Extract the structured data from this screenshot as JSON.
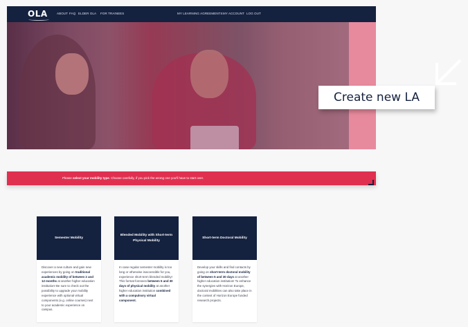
{
  "nav": {
    "logo": "OLA",
    "links_left": [
      "ABOUT",
      "FAQ",
      "ELDER OLA",
      "FOR TRAINEES"
    ],
    "links_right": [
      "MY LEARNING AGREEMENTS",
      "MY ACCOUNT",
      "LOG OUT"
    ]
  },
  "hero": {
    "cta_label": "Create new LA",
    "icon": "arrow-down-left-icon"
  },
  "banner": {
    "prefix": "Please ",
    "bold": "select your mobility type",
    "suffix": ". Choose carefully, if you pick the wrong one you'll have to start over."
  },
  "cards": [
    {
      "title": "Semester Mobility",
      "body": [
        {
          "t": "Discover a new culture and gain new experiences by going on "
        },
        {
          "t": "traditional academic mobility of between 2 and 12 months",
          "b": true
        },
        {
          "t": " at another higher education institution! Be sure to check out the possibility to upgrade your mobility experience with optional virtual components (e.g. online courses) next to your academic experience on campus."
        }
      ]
    },
    {
      "title": "Blended Mobility with Short-term Physical Mobility",
      "body": [
        {
          "t": "In case regular semester mobility is too long or otherwise inaccessible for you, experience short-term blended mobility! This format foresees "
        },
        {
          "t": "between 5 and 30 days of physical mobility",
          "b": true
        },
        {
          "t": " at another higher education institution "
        },
        {
          "t": "combined with a compulsory virtual component.",
          "b": true
        }
      ]
    },
    {
      "title": "Short-term Doctoral Mobility",
      "body": [
        {
          "t": "Develop your skills and find contacts by going on "
        },
        {
          "t": "short-term doctoral mobility of between 5 and 30 days",
          "b": true
        },
        {
          "t": " at another higher education institution! To enhance the synergies with Horizon Europe, doctoral mobilities can also take place in the context of Horizon Europe funded research projects."
        }
      ]
    }
  ],
  "colors": {
    "navy": "#14213f",
    "banner": "#e03050",
    "pink_panel": "#e88a9e"
  }
}
